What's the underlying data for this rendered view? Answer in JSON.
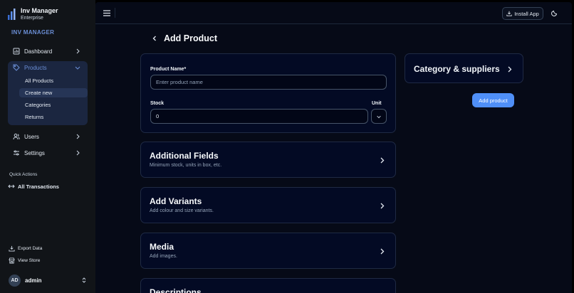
{
  "brand": {
    "title": "Inv Manager",
    "subtitle": "Enterprise",
    "accent": "#6b8fd6"
  },
  "sidebar": {
    "section_label": "INV MANAGER",
    "items": [
      {
        "label": "Dashboard",
        "icon": "dashboard-icon"
      },
      {
        "label": "Products",
        "icon": "tag-icon",
        "expanded": true
      },
      {
        "label": "Users",
        "icon": "users-icon"
      },
      {
        "label": "Settings",
        "icon": "settings-sliders-icon"
      }
    ],
    "products_submenu": [
      {
        "label": "All Products"
      },
      {
        "label": "Create new",
        "current": true
      },
      {
        "label": "Categories"
      },
      {
        "label": "Returns"
      }
    ],
    "quick_actions_label": "Quick Actions",
    "quick_actions": [
      {
        "label": "All Transactions",
        "icon": "arrows-left-right-icon"
      }
    ],
    "footer": [
      {
        "label": "Export Data",
        "icon": "download-icon"
      },
      {
        "label": "View Store",
        "icon": "store-icon"
      }
    ],
    "user": {
      "initials": "AD",
      "name": "admin"
    }
  },
  "topbar": {
    "install_label": "Install App"
  },
  "page": {
    "title": "Add Product"
  },
  "form": {
    "product_name_label": "Product Name*",
    "product_name_placeholder": "Enter product name",
    "product_name_value": "",
    "stock_label": "Stock",
    "stock_value": "0",
    "unit_label": "Unit"
  },
  "sections": [
    {
      "title": "Additional Fields",
      "description": "Minimum stock, units in box, etc."
    },
    {
      "title": "Add Variants",
      "description": "Add colour and size variants."
    },
    {
      "title": "Media",
      "description": "Add images."
    },
    {
      "title": "Descriptions",
      "description": ""
    }
  ],
  "side_panel": {
    "title": "Category & suppliers",
    "add_button": "Add product",
    "button_color": "#4f8ff7"
  }
}
